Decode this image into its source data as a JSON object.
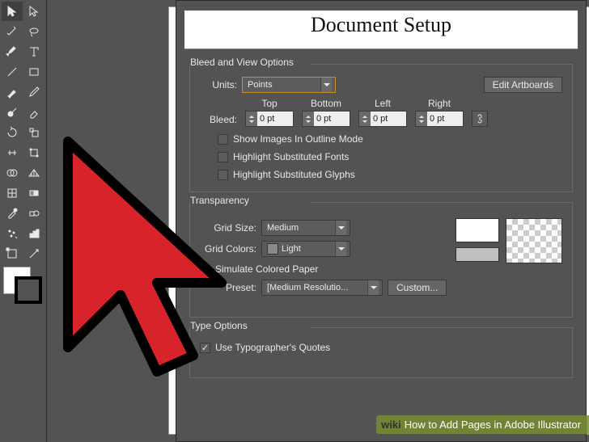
{
  "dialog": {
    "title": "Document Setup",
    "bleed_group": {
      "title": "Bleed and View Options",
      "units_label": "Units:",
      "units_value": "Points",
      "edit_artboards": "Edit Artboards",
      "bleed_label": "Bleed:",
      "top_label": "Top",
      "bottom_label": "Bottom",
      "left_label": "Left",
      "right_label": "Right",
      "top_value": "0 pt",
      "bottom_value": "0 pt",
      "left_value": "0 pt",
      "right_value": "0 pt",
      "show_images": "Show Images In Outline Mode",
      "hl_fonts": "Highlight Substituted Fonts",
      "hl_glyphs": "Highlight Substituted Glyphs"
    },
    "trans_group": {
      "title": "Transparency",
      "grid_size_label": "Grid Size:",
      "grid_size_value": "Medium",
      "grid_colors_label": "Grid Colors:",
      "grid_colors_value": "Light",
      "simulate": "Simulate Colored Paper",
      "preset_label": "Preset:",
      "preset_value": "[Medium Resolutio...",
      "custom": "Custom..."
    },
    "type_group": {
      "title": "Type Options",
      "typographers": "Use Typographer's Quotes"
    }
  },
  "watermark": {
    "brand": "wiki",
    "text": "How to Add Pages in Adobe Illustrator"
  }
}
